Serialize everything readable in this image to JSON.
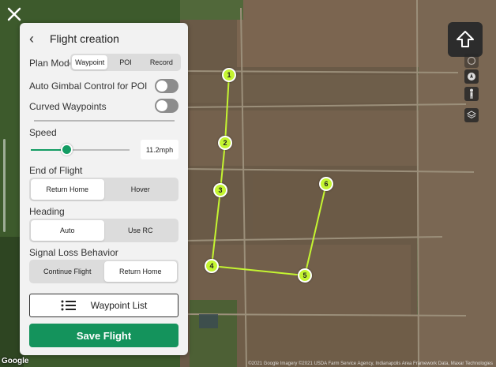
{
  "map": {
    "attribution": "Google",
    "copyright": "©2021 Google Imagery ©2021 USDA Farm Service Agency, Indianapolis Area Framework Data, Maxar Technologies",
    "waypoints": [
      "1",
      "2",
      "3",
      "4",
      "5",
      "6"
    ],
    "path_color": "#c4f531"
  },
  "icons": {
    "close": "close-icon",
    "home_point": "home-arrow-icon",
    "compass": "compass-icon",
    "person": "person-icon",
    "layers": "layers-icon",
    "list": "list-icon"
  },
  "panel": {
    "title": "Flight creation",
    "plan_mode": {
      "label": "Plan Mode",
      "options": [
        "Waypoint",
        "POI",
        "Record"
      ],
      "selected": "Waypoint"
    },
    "auto_gimbal": {
      "label": "Auto Gimbal Control for POI",
      "on": false
    },
    "curved_waypoints": {
      "label": "Curved Waypoints",
      "on": false
    },
    "speed": {
      "label": "Speed",
      "value": "11.2mph",
      "level": 0.36
    },
    "end_of_flight": {
      "label": "End of Flight",
      "options": [
        "Return Home",
        "Hover"
      ],
      "selected": "Return Home"
    },
    "heading": {
      "label": "Heading",
      "options": [
        "Auto",
        "Use RC"
      ],
      "selected": "Auto"
    },
    "signal_loss": {
      "label": "Signal Loss Behavior",
      "options": [
        "Continue Flight",
        "Return Home"
      ],
      "selected": "Return Home"
    },
    "waypoint_list_label": "Waypoint List",
    "save_label": "Save Flight"
  },
  "colors": {
    "accent": "#139c63",
    "save_button": "#14935c",
    "waypoint": "#c4f531"
  }
}
